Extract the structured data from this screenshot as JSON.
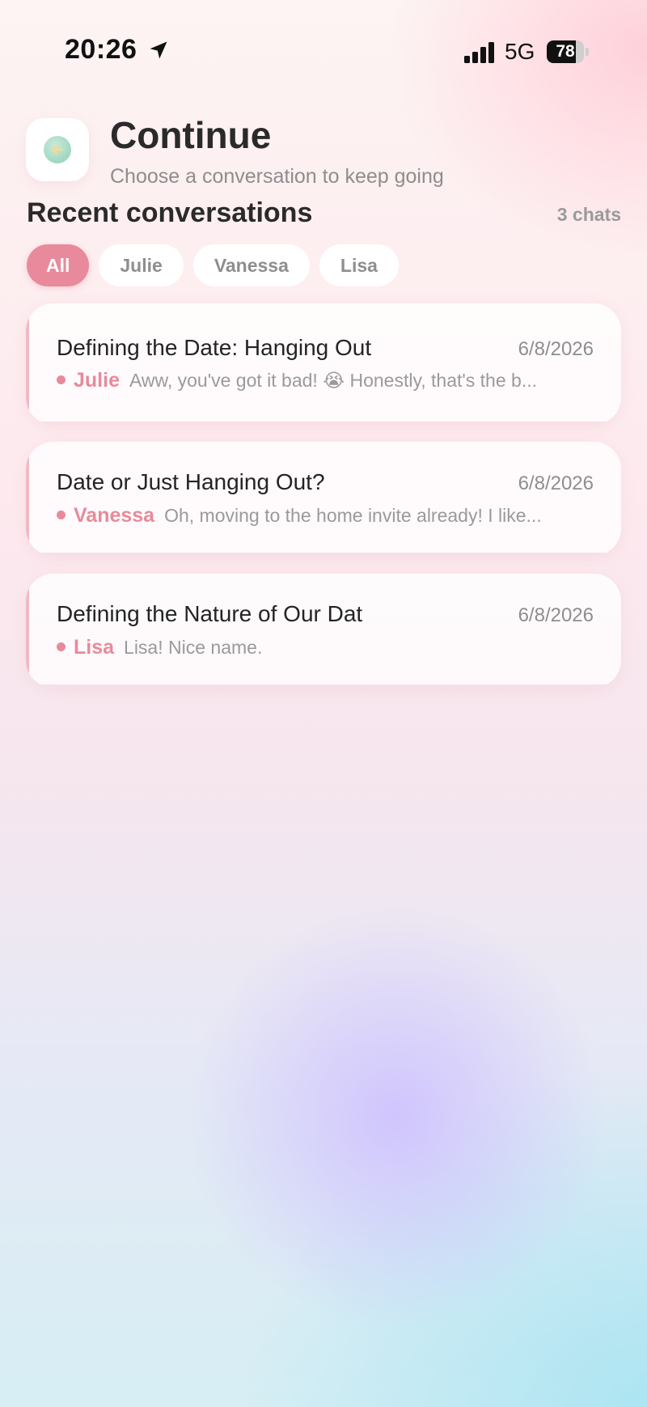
{
  "status_bar": {
    "time": "20:26",
    "network": "5G",
    "battery": "78",
    "battery_fraction": 0.78,
    "icons": [
      "location-arrow-icon",
      "signal-bars-icon",
      "battery-icon"
    ]
  },
  "header": {
    "back_icon": "arrow-left-icon",
    "title": "Continue",
    "subtitle": "Choose a conversation to keep going"
  },
  "section": {
    "title": "Recent conversations",
    "count": "3 chats"
  },
  "filters": [
    {
      "label": "All",
      "active": true
    },
    {
      "label": "Julie",
      "active": false
    },
    {
      "label": "Vanessa",
      "active": false
    },
    {
      "label": "Lisa",
      "active": false
    }
  ],
  "conversations": [
    {
      "title": "Defining the Date: Hanging Out",
      "date": "6/8/2026",
      "name": "Julie",
      "preview": "Aww, you've got it bad! 😭 Honestly, that's the b..."
    },
    {
      "title": "Date or Just Hanging Out?",
      "date": "6/8/2026",
      "name": "Vanessa",
      "preview": "Oh, moving to the home invite already! I like..."
    },
    {
      "title": "Defining the Nature of Our Dat",
      "date": "6/8/2026",
      "name": "Lisa",
      "preview": "Lisa! Nice name."
    }
  ],
  "colors": {
    "accent": "#e88a9b",
    "text_primary": "#2a2a2a",
    "text_secondary": "#8e8e8e"
  }
}
